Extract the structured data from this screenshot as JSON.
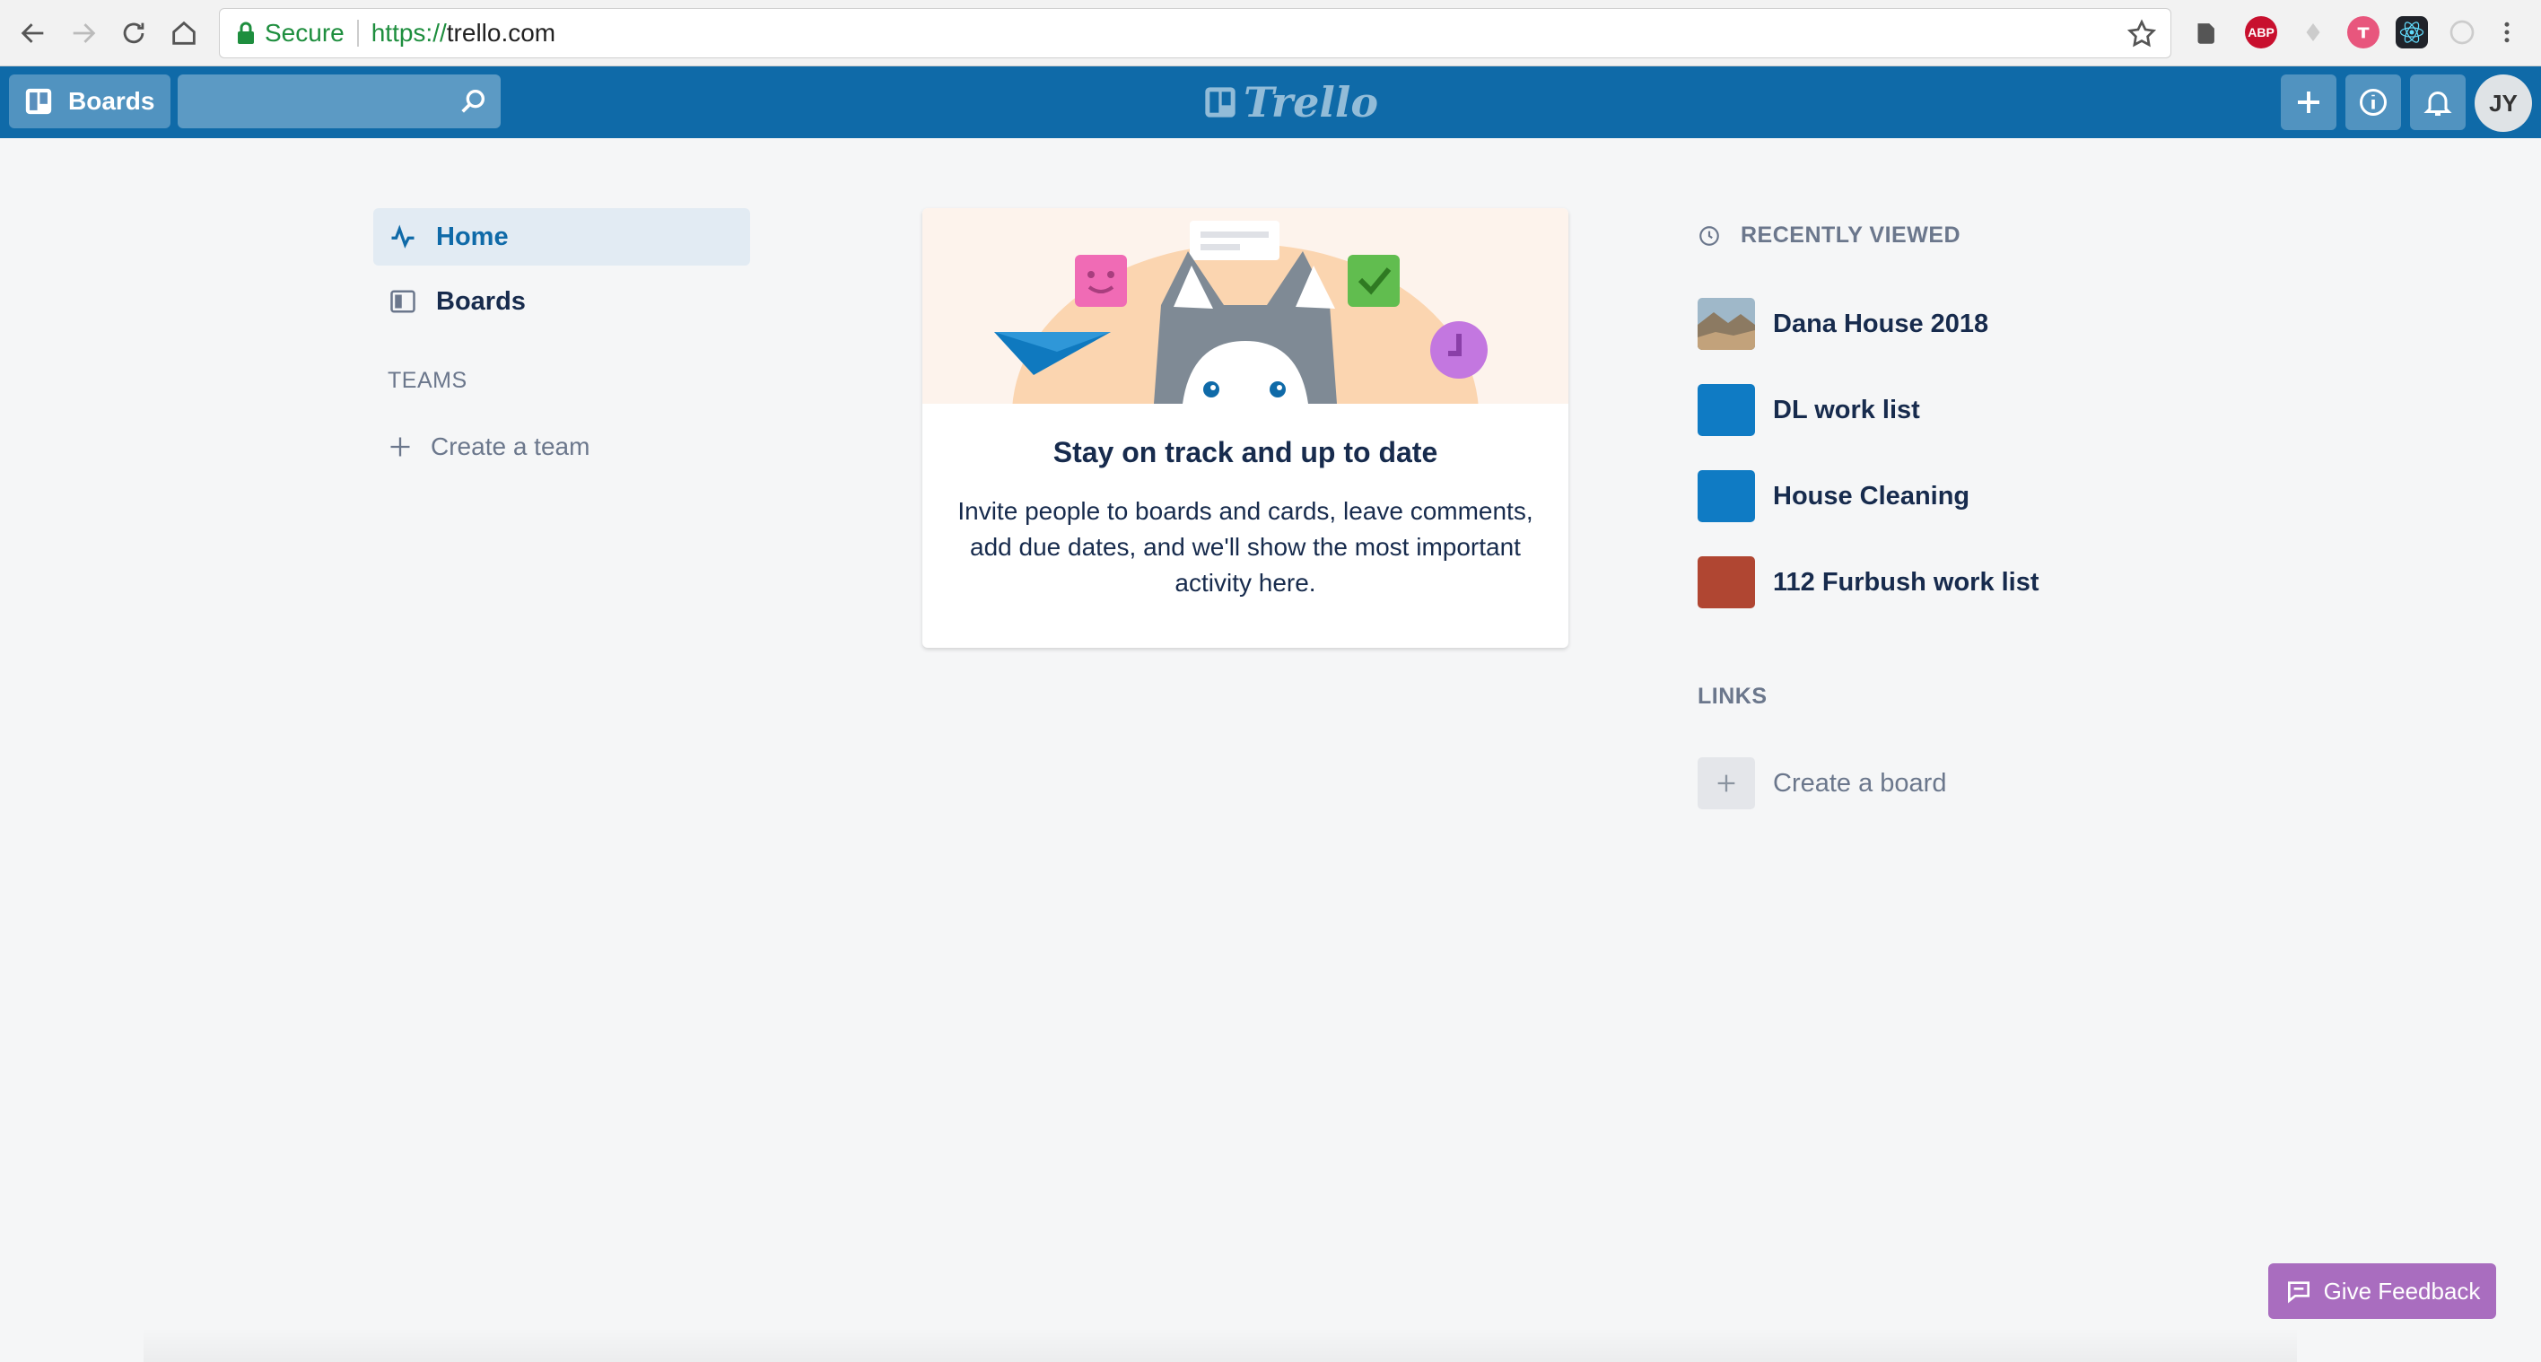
{
  "browser": {
    "secure_label": "Secure",
    "url_protocol": "https://",
    "url_host": "trello.com",
    "extensions": [
      "evernote-icon",
      "adblock-icon",
      "ext-icon",
      "trello-ext-icon",
      "react-icon",
      "ext2-icon"
    ],
    "adblock_label": "ABP"
  },
  "header": {
    "boards_label": "Boards",
    "logo_text": "Trello",
    "avatar_initials": "JY",
    "color": "#0f6aa8"
  },
  "sidebar": {
    "items": [
      {
        "label": "Home",
        "icon": "activity-icon",
        "active": true
      },
      {
        "label": "Boards",
        "icon": "board-icon",
        "active": false
      }
    ],
    "teams_label": "TEAMS",
    "create_team_label": "Create a team"
  },
  "card": {
    "title": "Stay on track and up to date",
    "body": "Invite people to boards and cards, leave comments, add due dates, and we'll show the most important activity here."
  },
  "recently_viewed": {
    "label": "RECENTLY VIEWED",
    "boards": [
      {
        "name": "Dana House 2018",
        "color": "photo"
      },
      {
        "name": "DL work list",
        "color": "#0f7bc4"
      },
      {
        "name": "House Cleaning",
        "color": "#0f7bc4"
      },
      {
        "name": "112 Furbush work list",
        "color": "#b04632"
      }
    ]
  },
  "links": {
    "label": "LINKS",
    "create_board_label": "Create a board"
  },
  "feedback": {
    "label": "Give Feedback",
    "color": "#a96dbf"
  }
}
